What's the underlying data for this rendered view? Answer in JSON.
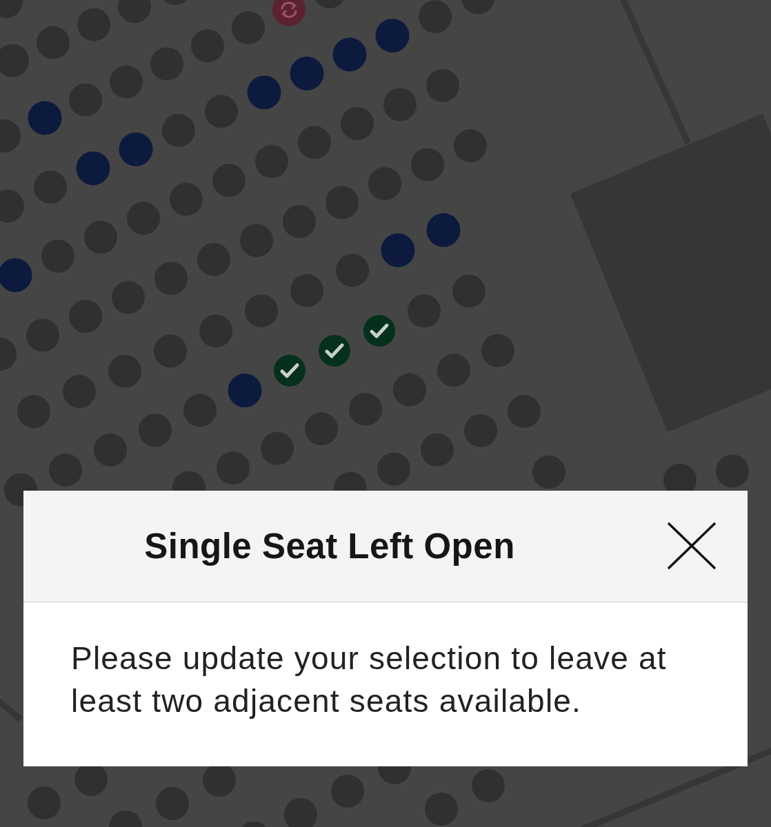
{
  "seat_map": {
    "sections": [
      {
        "rows": [
          {
            "seats": [
              {
                "kind": "taken",
                "selected": false
              }
            ]
          },
          {
            "seats": [
              {
                "kind": "taken",
                "selected": false
              },
              {
                "kind": "taken",
                "selected": false
              },
              {
                "kind": "taken",
                "selected": false
              },
              {
                "kind": "taken",
                "selected": false
              },
              {
                "kind": "taken",
                "selected": false
              }
            ]
          },
          {
            "seats": [
              {
                "kind": "taken",
                "selected": false
              },
              {
                "kind": "available",
                "selected": false
              },
              {
                "kind": "taken",
                "selected": false
              },
              {
                "kind": "taken",
                "selected": false
              },
              {
                "kind": "taken",
                "selected": false
              },
              {
                "kind": "taken",
                "selected": false
              },
              {
                "kind": "taken",
                "selected": false
              },
              {
                "kind": "special",
                "selected": false
              },
              {
                "kind": "taken",
                "selected": false
              }
            ]
          },
          {
            "seats": [
              {
                "kind": "taken",
                "selected": false
              },
              {
                "kind": "taken",
                "selected": false
              },
              {
                "kind": "available",
                "selected": false
              },
              {
                "kind": "available",
                "selected": false
              },
              {
                "kind": "taken",
                "selected": false
              },
              {
                "kind": "taken",
                "selected": false
              },
              {
                "kind": "available",
                "selected": false
              },
              {
                "kind": "available",
                "selected": false
              },
              {
                "kind": "available",
                "selected": false
              },
              {
                "kind": "available",
                "selected": false
              },
              {
                "kind": "taken",
                "selected": false
              },
              {
                "kind": "taken",
                "selected": false
              }
            ]
          },
          {
            "seats": [
              {
                "kind": "available",
                "selected": false
              },
              {
                "kind": "taken",
                "selected": false
              },
              {
                "kind": "taken",
                "selected": false
              },
              {
                "kind": "taken",
                "selected": false
              },
              {
                "kind": "taken",
                "selected": false
              },
              {
                "kind": "taken",
                "selected": false
              },
              {
                "kind": "taken",
                "selected": false
              },
              {
                "kind": "taken",
                "selected": false
              },
              {
                "kind": "taken",
                "selected": false
              },
              {
                "kind": "taken",
                "selected": false
              },
              {
                "kind": "taken",
                "selected": false
              }
            ]
          },
          {
            "seats": [
              {
                "kind": "taken",
                "selected": false
              },
              {
                "kind": "taken",
                "selected": false
              },
              {
                "kind": "taken",
                "selected": false
              },
              {
                "kind": "taken",
                "selected": false
              },
              {
                "kind": "taken",
                "selected": false
              },
              {
                "kind": "taken",
                "selected": false
              },
              {
                "kind": "taken",
                "selected": false
              },
              {
                "kind": "taken",
                "selected": false
              },
              {
                "kind": "taken",
                "selected": false
              },
              {
                "kind": "taken",
                "selected": false
              },
              {
                "kind": "taken",
                "selected": false
              },
              {
                "kind": "taken",
                "selected": false
              }
            ]
          },
          {
            "seats": [
              {
                "kind": "taken",
                "selected": false
              },
              {
                "kind": "taken",
                "selected": false
              },
              {
                "kind": "taken",
                "selected": false
              },
              {
                "kind": "taken",
                "selected": false
              },
              {
                "kind": "taken",
                "selected": false
              },
              {
                "kind": "taken",
                "selected": false
              },
              {
                "kind": "taken",
                "selected": false
              },
              {
                "kind": "taken",
                "selected": false
              },
              {
                "kind": "available",
                "selected": false
              },
              {
                "kind": "available",
                "selected": false
              }
            ]
          },
          {
            "seats": [
              {
                "kind": "taken",
                "selected": false
              },
              {
                "kind": "taken",
                "selected": false
              },
              {
                "kind": "taken",
                "selected": false
              },
              {
                "kind": "taken",
                "selected": false
              },
              {
                "kind": "taken",
                "selected": false
              },
              {
                "kind": "available",
                "selected": false
              },
              {
                "kind": "available",
                "selected": true
              },
              {
                "kind": "available",
                "selected": true
              },
              {
                "kind": "available",
                "selected": true
              },
              {
                "kind": "taken",
                "selected": false
              },
              {
                "kind": "taken",
                "selected": false
              }
            ]
          },
          {
            "seats": [
              {
                "kind": "taken",
                "selected": false
              },
              {
                "kind": "taken",
                "selected": false
              },
              {
                "kind": "taken",
                "selected": false
              },
              {
                "kind": "taken",
                "selected": false
              },
              {
                "kind": "taken",
                "selected": false
              },
              {
                "kind": "taken",
                "selected": false
              },
              {
                "kind": "taken",
                "selected": false
              },
              {
                "kind": "taken",
                "selected": false
              }
            ]
          },
          {
            "seats": [
              {
                "kind": "taken",
                "selected": false
              },
              {
                "kind": "taken",
                "selected": false
              },
              {
                "kind": "taken",
                "selected": false
              },
              {
                "kind": "taken",
                "selected": false
              },
              {
                "kind": "taken",
                "selected": false
              }
            ]
          },
          {
            "seats": [
              {
                "kind": "taken",
                "selected": false
              }
            ]
          }
        ]
      },
      {
        "rows": [
          {
            "seats": [
              {
                "kind": "taken",
                "selected": false
              },
              {
                "kind": "taken",
                "selected": false
              }
            ]
          }
        ]
      },
      {
        "rows": [
          {
            "seats": [
              {
                "kind": "taken",
                "selected": false
              },
              {
                "kind": "taken",
                "selected": false
              }
            ]
          },
          {
            "seats": [
              {
                "kind": "taken",
                "selected": false
              },
              {
                "kind": "taken",
                "selected": false
              },
              {
                "kind": "taken",
                "selected": false
              }
            ]
          },
          {
            "seats": [
              {
                "kind": "taken",
                "selected": false
              },
              {
                "kind": "taken",
                "selected": false
              },
              {
                "kind": "taken",
                "selected": false
              },
              {
                "kind": "taken",
                "selected": false
              }
            ]
          },
          {
            "seats": [
              {
                "kind": "taken",
                "selected": false
              },
              {
                "kind": "taken",
                "selected": false
              }
            ]
          }
        ]
      }
    ]
  },
  "dialog": {
    "title": "Single Seat Left Open",
    "message": "Please update your selection to leave at least two adjacent seats available."
  }
}
